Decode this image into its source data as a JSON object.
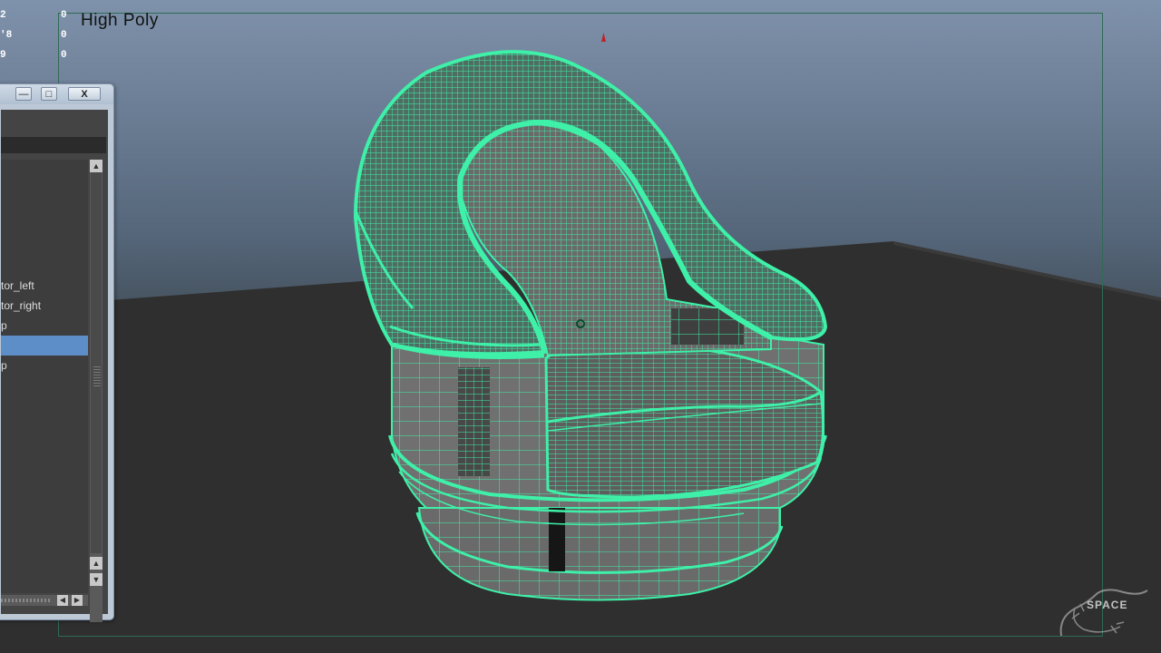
{
  "viewport": {
    "label": "High Poly",
    "hud_left": [
      "2",
      "'8",
      "9"
    ],
    "hud_right": [
      "0",
      "0",
      "0"
    ],
    "wireframe_color": "#3ef0a8",
    "floor_color": "#2f2f2f",
    "sky_color": "#7f92ab"
  },
  "outliner": {
    "minimize_icon": "minimize-icon",
    "maximize_icon": "maximize-icon",
    "close_label": "X",
    "filter_value": "",
    "items": [
      {
        "label": ""
      },
      {
        "label": ""
      },
      {
        "label": ""
      },
      {
        "label": ""
      },
      {
        "label": ""
      },
      {
        "label": "tor_left"
      },
      {
        "label": "tor_right"
      },
      {
        "label": "p"
      },
      {
        "label": "",
        "selected": true
      },
      {
        "label": "p"
      }
    ],
    "scroll_up": "▲",
    "scroll_down": "▼",
    "scroll_left": "◀",
    "scroll_right": "▶",
    "selection_color": "#5e8ec8"
  },
  "watermark": {
    "text": "SPACE",
    "icon": "gecko-logo-icon"
  }
}
